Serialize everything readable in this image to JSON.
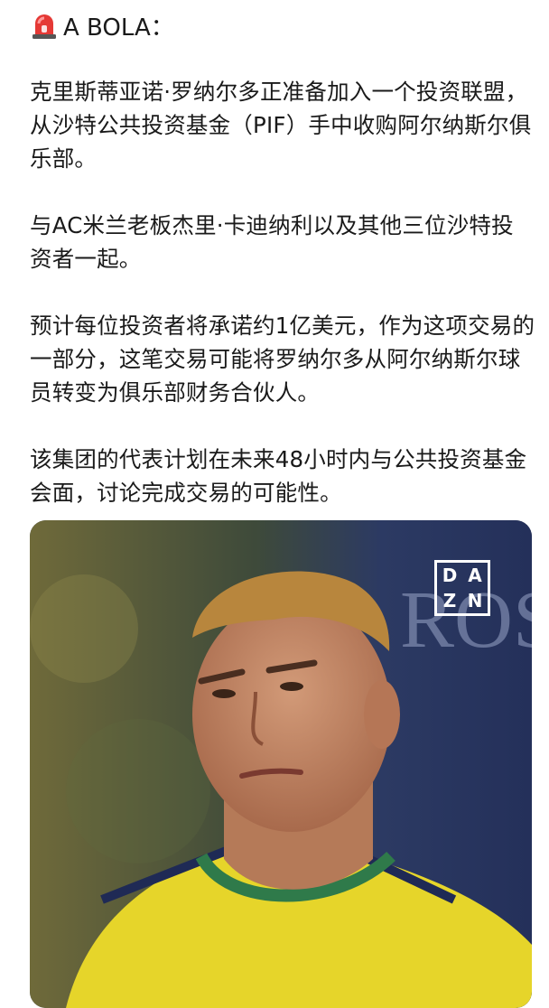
{
  "post": {
    "source_label": "A BOLA：",
    "paragraphs": [
      "克里斯蒂亚诺·罗纳尔多正准备加入一个投资联盟，从沙特公共投资基金（PIF）手中收购阿尔纳斯尔俱乐部。",
      "与AC米兰老板杰里·卡迪纳利以及其他三位沙特投资者一起。",
      "预计每位投资者将承诺约1亿美元，作为这项交易的一部分，这笔交易可能将罗纳尔多从阿尔纳斯尔球员转变为俱乐部财务合伙人。",
      "该集团的代表计划在未来48小时内与公共投资基金会面，讨论完成交易的可能性。"
    ]
  },
  "photo": {
    "logo_letters": [
      "D",
      "A",
      "Z",
      "N"
    ],
    "background_text": "ROS"
  },
  "colors": {
    "siren_red": "#e53935",
    "jersey_yellow": "#e6d52a",
    "jersey_navy": "#1f2a55"
  }
}
